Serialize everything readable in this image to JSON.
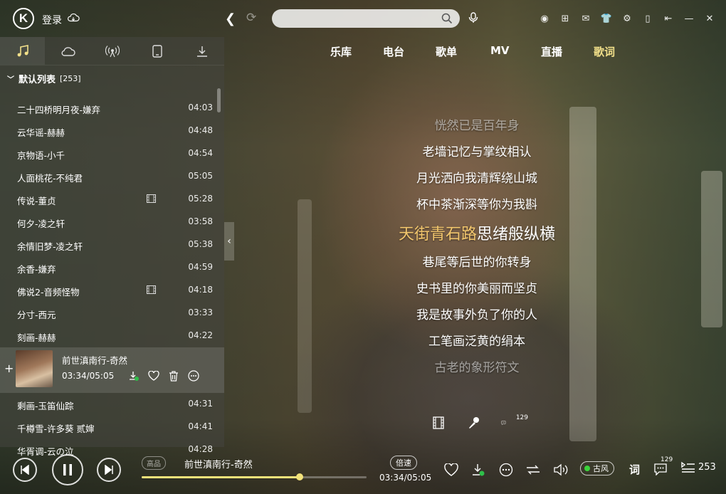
{
  "topbar": {
    "login_label": "登录",
    "search_placeholder": ""
  },
  "left_tabs": [
    {
      "icon": "music-note-icon",
      "active": true
    },
    {
      "icon": "cloud-icon",
      "active": false
    },
    {
      "icon": "radio-icon",
      "active": false
    },
    {
      "icon": "phone-icon",
      "active": false
    },
    {
      "icon": "download-icon",
      "active": false
    }
  ],
  "playlist": {
    "name": "默认列表",
    "count": "[253]",
    "songs_before": [
      {
        "title": "二十四桥明月夜-嫌弃",
        "duration": "04:03",
        "mv": false
      },
      {
        "title": "云华谣-赫赫",
        "duration": "04:48",
        "mv": false
      },
      {
        "title": "京物语-小千",
        "duration": "04:54",
        "mv": false
      },
      {
        "title": "人面桃花-不纯君",
        "duration": "05:05",
        "mv": false
      },
      {
        "title": "传说-董贞",
        "duration": "05:28",
        "mv": true
      },
      {
        "title": "何夕-凌之轩",
        "duration": "03:58",
        "mv": false
      },
      {
        "title": "余情旧梦-凌之轩",
        "duration": "05:38",
        "mv": false
      },
      {
        "title": "余香-嫌弃",
        "duration": "04:59",
        "mv": false
      },
      {
        "title": "佛说2-音频怪物",
        "duration": "04:18",
        "mv": true
      },
      {
        "title": "分寸-西元",
        "duration": "03:33",
        "mv": false
      },
      {
        "title": "刻画-赫赫",
        "duration": "04:22",
        "mv": false
      }
    ],
    "playing": {
      "title": "前世滇南行-奇然",
      "time": "03:34/05:05"
    },
    "songs_after": [
      {
        "title": "剩画-玉笛仙踪",
        "duration": "04:31"
      },
      {
        "title": "千樽雪-许多葵 贰婶",
        "duration": "04:41"
      },
      {
        "title": "华胥调-云の泣",
        "duration": "04:28"
      }
    ]
  },
  "main_nav": [
    "乐库",
    "电台",
    "歌单",
    "MV",
    "直播",
    "歌词"
  ],
  "lyrics": {
    "lines_before": [
      "恍然已是百年身",
      "老墙记忆与掌纹相认",
      "月光洒向我清辉绕山城",
      "杯中茶渐深等你为我斟"
    ],
    "current_sung": "天街青石路",
    "current_rest": "思绪般纵横",
    "lines_after": [
      "巷尾等后世的你转身",
      "史书里的你美丽而坚贞",
      "我是故事外负了你的人",
      "工笔画泛黄的绢本",
      "古老的象形符文"
    ],
    "comment_count": "129"
  },
  "player": {
    "quality": "高品",
    "title": "前世滇南行-奇然",
    "speed": "倍速",
    "time": "03:34/05:05",
    "progress_fraction": 0.703,
    "effect": "古风",
    "lyric_toggle": "词",
    "comment_count": "129",
    "playlist_count": "253"
  },
  "colors": {
    "accent_lyric": "#f2c66d",
    "active_nav": "#f2e08a",
    "progress": "#f2e27a"
  }
}
